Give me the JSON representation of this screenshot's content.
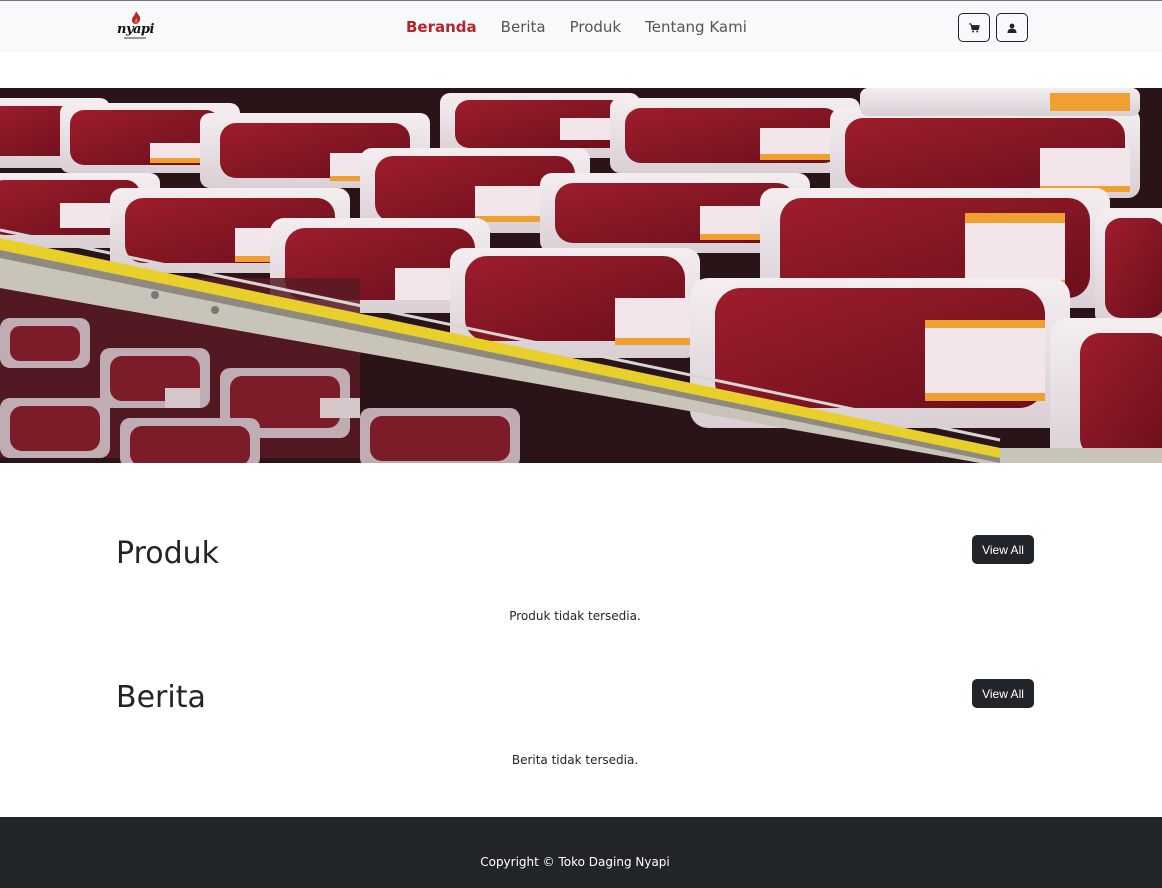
{
  "navbar": {
    "logo_text": "nyapi",
    "links": [
      {
        "label": "Beranda",
        "active": true
      },
      {
        "label": "Berita",
        "active": false
      },
      {
        "label": "Produk",
        "active": false
      },
      {
        "label": "Tentang Kami",
        "active": false
      }
    ],
    "icons": {
      "cart": "cart-icon",
      "user": "user-icon"
    }
  },
  "hero": {
    "image": "meat-display-photo"
  },
  "sections": {
    "produk": {
      "title": "Produk",
      "view_all": "View All",
      "empty": "Produk tidak tersedia."
    },
    "berita": {
      "title": "Berita",
      "view_all": "View All",
      "empty": "Berita tidak tersedia."
    }
  },
  "footer": {
    "copyright": "Copyright © Toko Daging Nyapi"
  },
  "colors": {
    "accent": "#b5232a",
    "dark": "#212529",
    "navbar_bg": "#f8f9fa"
  }
}
